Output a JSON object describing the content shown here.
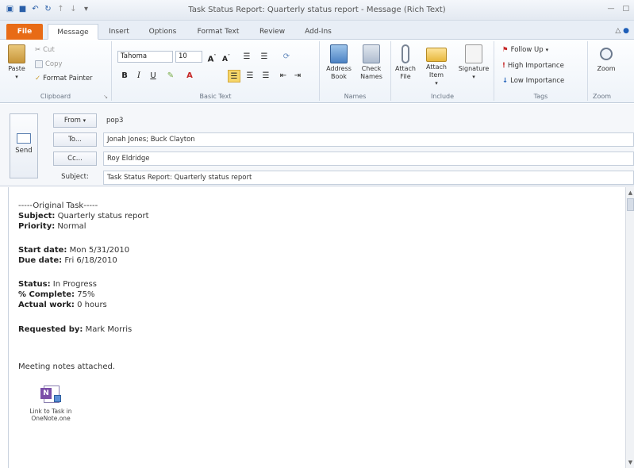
{
  "window": {
    "title": "Task Status Report: Quarterly status report  -  Message (Rich Text)"
  },
  "tabs": [
    "File",
    "Message",
    "Insert",
    "Options",
    "Format Text",
    "Review",
    "Add-Ins"
  ],
  "ribbon": {
    "clipboard": {
      "paste": "Paste",
      "cut": "Cut",
      "copy": "Copy",
      "format_painter": "Format Painter",
      "label": "Clipboard"
    },
    "basic_text": {
      "font": "Tahoma",
      "size": "10",
      "label": "Basic Text"
    },
    "names": {
      "address_book": "Address Book",
      "check_names": "Check Names",
      "label": "Names"
    },
    "include": {
      "attach_file": "Attach File",
      "attach_item": "Attach Item",
      "signature": "Signature",
      "label": "Include"
    },
    "tags": {
      "follow_up": "Follow Up",
      "high_importance": "High Importance",
      "low_importance": "Low Importance",
      "label": "Tags"
    },
    "zoom": {
      "zoom": "Zoom",
      "label": "Zoom"
    }
  },
  "header": {
    "send": "Send",
    "from_btn": "From",
    "from_value": "pop3",
    "to_btn": "To...",
    "to_value": "Jonah Jones; Buck Clayton",
    "cc_btn": "Cc...",
    "cc_value": "Roy Eldridge",
    "subject_label": "Subject:",
    "subject_value": "Task Status Report: Quarterly status report"
  },
  "body": {
    "original_task": "-----Original Task-----",
    "subject_label": "Subject:",
    "subject_value": "Quarterly status report",
    "priority_label": "Priority:",
    "priority_value": "Normal",
    "start_label": "Start date:",
    "start_value": "Mon 5/31/2010",
    "due_label": "Due date:",
    "due_value": "Fri 6/18/2010",
    "status_label": "Status:",
    "status_value": "In Progress",
    "complete_label": "% Complete:",
    "complete_value": "75%",
    "actual_label": "Actual work:",
    "actual_value": "0 hours",
    "requested_label": "Requested by:",
    "requested_value": "Mark Morris",
    "notes": "Meeting notes attached.",
    "attachment_line1": "Link to Task in",
    "attachment_line2": "OneNote.one"
  },
  "colors": {
    "file_tab": "#e86b16",
    "high_importance": "#c62828",
    "low_importance": "#1f5fb8"
  }
}
